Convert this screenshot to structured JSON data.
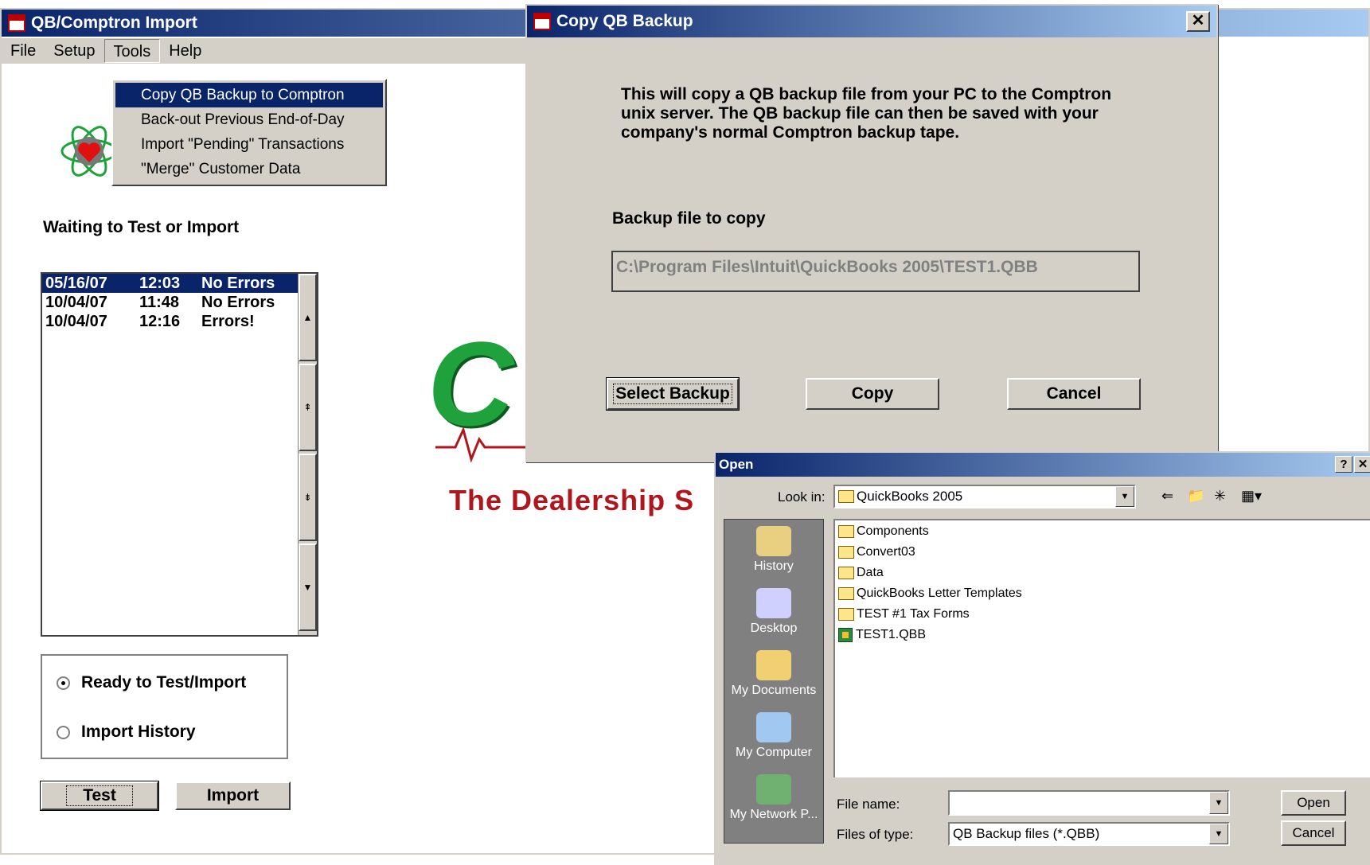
{
  "main_window": {
    "title": "QB/Comptron Import",
    "menu": [
      "File",
      "Setup",
      "Tools",
      "Help"
    ],
    "tools_menu": [
      "Copy QB Backup to Comptron",
      "Back-out Previous End-of-Day",
      "Import \"Pending\" Transactions",
      "\"Merge\" Customer Data"
    ],
    "status": "Waiting to Test or Import",
    "history": [
      {
        "date": "05/16/07",
        "time": "12:03",
        "result": "No Errors"
      },
      {
        "date": "10/04/07",
        "time": "11:48",
        "result": "No Errors"
      },
      {
        "date": "10/04/07",
        "time": "12:16",
        "result": "Errors!"
      }
    ],
    "mode_options": [
      "Ready to Test/Import",
      "Import History"
    ],
    "selected_mode": "Ready to Test/Import",
    "buttons": {
      "test": "Test",
      "import": "Import"
    },
    "logo_letters": "C",
    "logo_tagline": "The Dealership S"
  },
  "copy_dialog": {
    "title": "Copy QB Backup",
    "description": "This will copy a QB backup file from your PC to the Comptron unix server. The QB backup file can then be saved with your company's normal Comptron backup tape.",
    "file_label": "Backup file to copy",
    "file_path": "C:\\Program Files\\Intuit\\QuickBooks 2005\\TEST1.QBB",
    "buttons": {
      "select": "Select Backup",
      "copy": "Copy",
      "cancel": "Cancel"
    }
  },
  "open_dialog": {
    "title": "Open",
    "look_in_label": "Look in:",
    "look_in_value": "QuickBooks 2005",
    "places": [
      "History",
      "Desktop",
      "My Documents",
      "My Computer",
      "My Network P..."
    ],
    "files": [
      {
        "name": "Components",
        "type": "folder"
      },
      {
        "name": "Convert03",
        "type": "folder"
      },
      {
        "name": "Data",
        "type": "folder"
      },
      {
        "name": "QuickBooks Letter Templates",
        "type": "folder"
      },
      {
        "name": "TEST #1 Tax Forms",
        "type": "folder"
      },
      {
        "name": "TEST1.QBB",
        "type": "qbb"
      }
    ],
    "file_name_label": "File name:",
    "file_name_value": "",
    "file_type_label": "Files of type:",
    "file_type_value": "QB Backup files (*.QBB)",
    "buttons": {
      "open": "Open",
      "cancel": "Cancel"
    }
  }
}
